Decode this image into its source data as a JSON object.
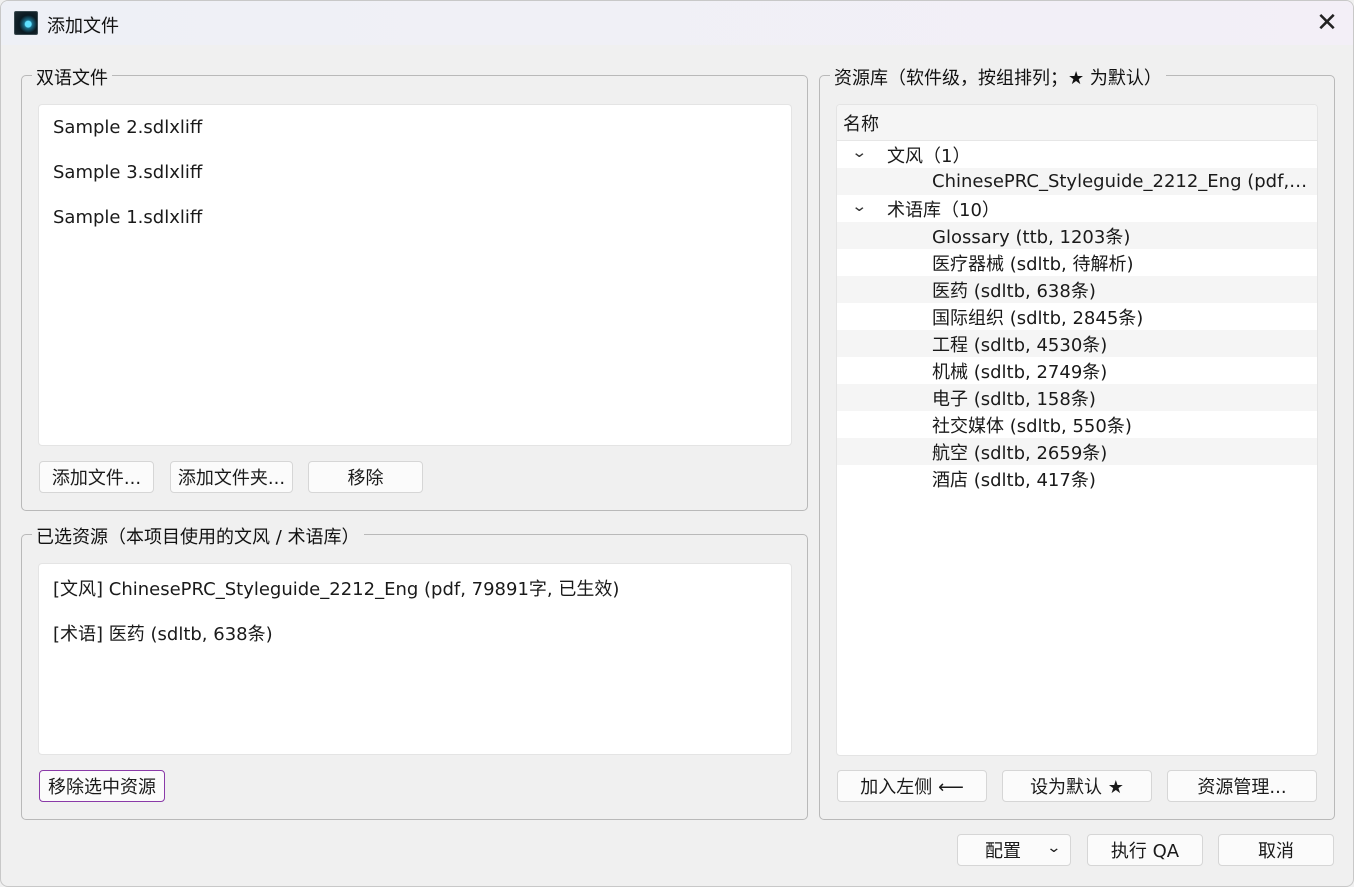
{
  "window": {
    "title": "添加文件",
    "close_glyph": "✕"
  },
  "bilingual": {
    "legend": "双语文件",
    "files": [
      "Sample 2.sdlxliff",
      "Sample 3.sdlxliff",
      "Sample 1.sdlxliff"
    ],
    "buttons": {
      "add_files": "添加文件...",
      "add_folder": "添加文件夹...",
      "remove": "移除"
    }
  },
  "selected": {
    "legend": "已选资源（本项目使用的文风 / 术语库）",
    "items": [
      "[文风] ChinesePRC_Styleguide_2212_Eng (pdf, 79891字, 已生效)",
      "[术语] 医药 (sdltb, 638条)"
    ],
    "remove_button": "移除选中资源"
  },
  "library": {
    "legend": "资源库（软件级，按组排列；★ 为默认）",
    "column_header": "名称",
    "groups": [
      {
        "label": "文风（1）",
        "expanded": true,
        "items": [
          "ChinesePRC_Styleguide_2212_Eng (pdf, 79..."
        ]
      },
      {
        "label": "术语库（10）",
        "expanded": true,
        "items": [
          "Glossary (ttb, 1203条)",
          "医疗器械 (sdltb, 待解析)",
          "医药 (sdltb, 638条)",
          "国际组织 (sdltb, 2845条)",
          "工程 (sdltb, 4530条)",
          "机械 (sdltb, 2749条)",
          "电子 (sdltb, 158条)",
          "社交媒体 (sdltb, 550条)",
          "航空 (sdltb, 2659条)",
          "酒店 (sdltb, 417条)"
        ]
      }
    ],
    "buttons": {
      "add_left": "加入左侧 ⟵",
      "set_default": "设为默认 ★",
      "manage": "资源管理..."
    }
  },
  "footer": {
    "config_select": "配置",
    "run_qa": "执行 QA",
    "cancel": "取消"
  },
  "colors": {
    "focus_border": "#8a3aa8",
    "alt_row": "#f5f5f5"
  }
}
